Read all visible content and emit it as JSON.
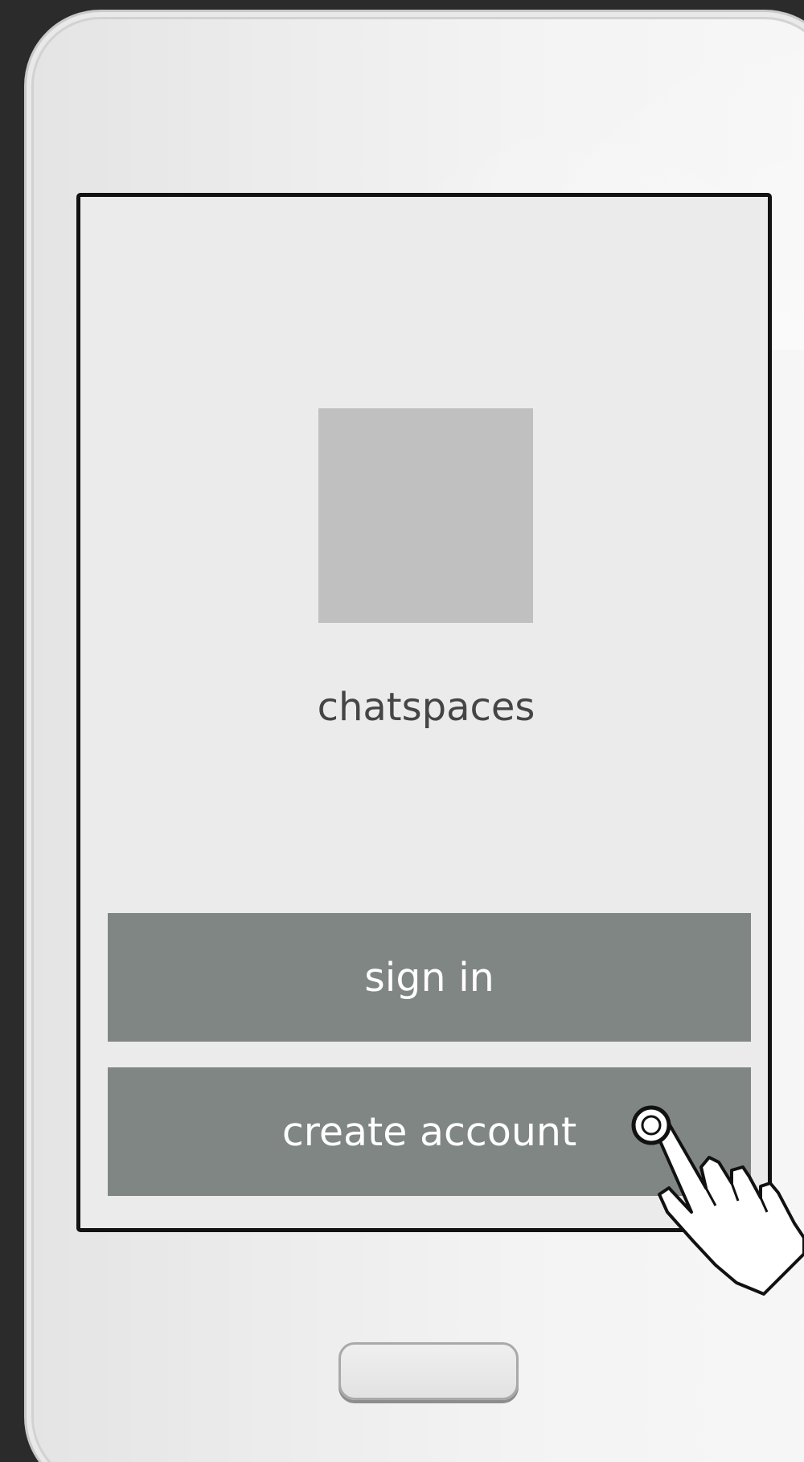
{
  "app": {
    "name": "chatspaces"
  },
  "buttons": {
    "sign_in": "sign in",
    "create_account": "create account"
  },
  "colors": {
    "screen_background": "#ebebeb",
    "button_fill": "#808684",
    "button_text": "#ffffff",
    "logo_placeholder": "#c0c0c0",
    "app_name_text": "#454545"
  },
  "icons": {
    "pointer": "hand-tap-icon",
    "home": "home-button"
  }
}
